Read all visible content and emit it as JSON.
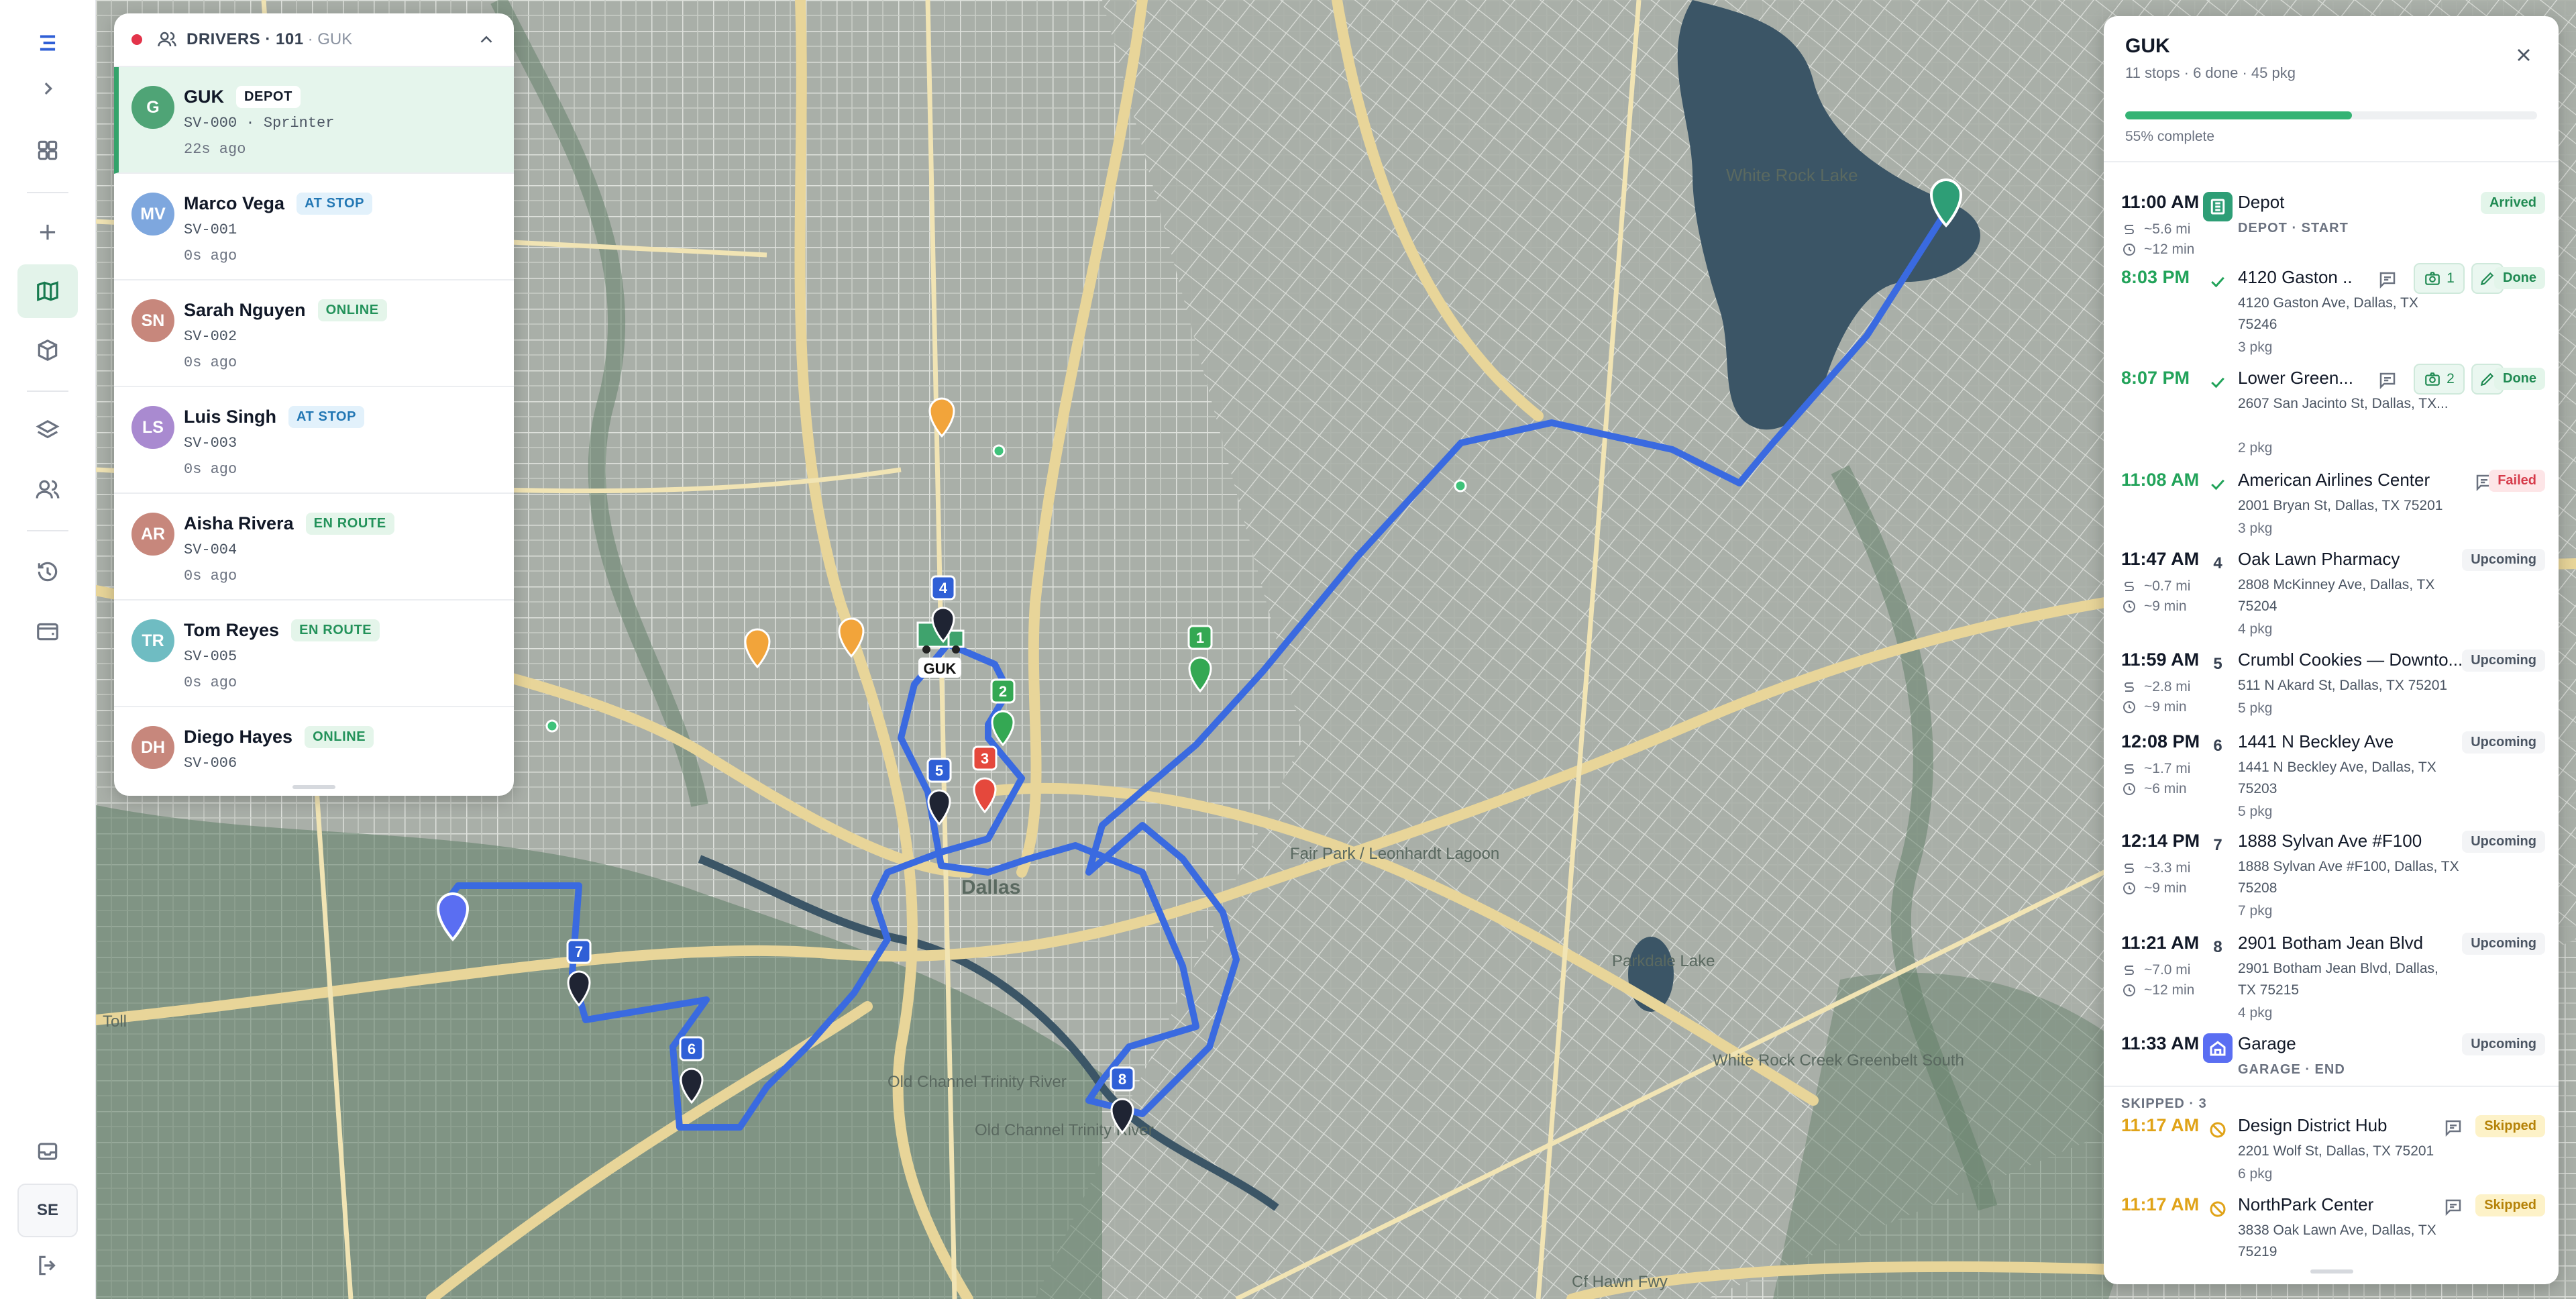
{
  "rail": {
    "items": [
      "logo",
      "expand",
      "dashboard",
      "add",
      "map",
      "packages",
      "layers",
      "users",
      "history",
      "wallet"
    ],
    "bottom": [
      "inbox",
      "user-initials",
      "logout"
    ],
    "user_initials": "SE"
  },
  "map": {
    "labels": [
      "White Rock Lake",
      "Dallas",
      "Parkdale Lake",
      "White Rock Creek Greenbelt South",
      "Old Channel Trinity River",
      "Old Channel Trinity River",
      "Fair Park / Leonhardt Lagoon",
      "Toll",
      "Cf Hawn Fwy"
    ],
    "markers": [
      {
        "label": "1",
        "color": "#34a853"
      },
      {
        "label": "2",
        "color": "#34a853"
      },
      {
        "label": "3",
        "color": "#e5483c"
      },
      {
        "label": "4",
        "color": "#2f5fd6"
      },
      {
        "label": "5",
        "color": "#2f5fd6"
      },
      {
        "label": "6",
        "color": "#2f5fd6"
      },
      {
        "label": "7",
        "color": "#2f5fd6"
      },
      {
        "label": "8",
        "color": "#2f5fd6"
      }
    ],
    "truck_label": "GUK"
  },
  "drivers": {
    "title": "DRIVERS · 101",
    "subtitle": "· GUK",
    "list": [
      {
        "initials": "G",
        "name": "GUK",
        "status": "DEPOT",
        "sub": "SV-000 · Sprinter",
        "time": "22s ago",
        "color": "#4fa476",
        "badge_bg": "#ffffff",
        "badge_fg": "#111827"
      },
      {
        "initials": "MV",
        "name": "Marco Vega",
        "status": "AT STOP",
        "sub": "SV-001",
        "time": "0s ago",
        "color": "#7ea7de",
        "badge_bg": "#e2f1fb",
        "badge_fg": "#2277b4"
      },
      {
        "initials": "SN",
        "name": "Sarah Nguyen",
        "status": "ONLINE",
        "sub": "SV-002",
        "time": "0s ago",
        "color": "#c7877c",
        "badge_bg": "#e4f5ea",
        "badge_fg": "#23925a"
      },
      {
        "initials": "LS",
        "name": "Luis Singh",
        "status": "AT STOP",
        "sub": "SV-003",
        "time": "0s ago",
        "color": "#a98ad0",
        "badge_bg": "#e2f1fb",
        "badge_fg": "#2277b4"
      },
      {
        "initials": "AR",
        "name": "Aisha Rivera",
        "status": "EN ROUTE",
        "sub": "SV-004",
        "time": "0s ago",
        "color": "#c7877c",
        "badge_bg": "#e4f5ea",
        "badge_fg": "#23925a"
      },
      {
        "initials": "TR",
        "name": "Tom Reyes",
        "status": "EN ROUTE",
        "sub": "SV-005",
        "time": "0s ago",
        "color": "#6fbcc2",
        "badge_bg": "#e4f5ea",
        "badge_fg": "#23925a"
      },
      {
        "initials": "DH",
        "name": "Diego Hayes",
        "status": "ONLINE",
        "sub": "SV-006",
        "time": "",
        "color": "#c7877c",
        "badge_bg": "#e4f5ea",
        "badge_fg": "#23925a"
      }
    ]
  },
  "route": {
    "title": "GUK",
    "summary": "11 stops · 6 done · 45 pkg",
    "progress_pct": 55,
    "progress_label": "55% complete",
    "stops": [
      {
        "time": "11:00 AM",
        "time_color": "default",
        "dist": "~5.6 mi",
        "dur": "~12 min",
        "marker": "depot",
        "name": "Depot",
        "addr": "DEPOT · START",
        "pkg": "",
        "status": "Arrived"
      },
      {
        "time": "8:03 PM",
        "time_color": "green",
        "marker": "check",
        "name": "4120 Gaston ...",
        "addr": "4120 Gaston Ave, Dallas, TX 75246",
        "pkg": "3 pkg",
        "photos": "1",
        "status": "Done"
      },
      {
        "time": "8:07 PM",
        "time_color": "green",
        "marker": "check",
        "name": "Lower Green...",
        "addr": "2607 San Jacinto St, Dallas, TX...",
        "pkg": "2 pkg",
        "photos": "2",
        "status": "Done"
      },
      {
        "time": "11:08 AM",
        "time_color": "green",
        "marker": "check",
        "name": "American Airlines Center",
        "addr": "2001 Bryan St, Dallas, TX 75201",
        "pkg": "3 pkg",
        "status": "Failed"
      },
      {
        "time": "11:47 AM",
        "time_color": "default",
        "dist": "~0.7 mi",
        "dur": "~9 min",
        "marker": "4",
        "name": "Oak Lawn Pharmacy",
        "addr": "2808 McKinney Ave, Dallas, TX 75204",
        "pkg": "4 pkg",
        "status": "Upcoming"
      },
      {
        "time": "11:59 AM",
        "time_color": "default",
        "dist": "~2.8 mi",
        "dur": "~9 min",
        "marker": "5",
        "name": "Crumbl Cookies — Downto...",
        "addr": "511 N Akard St, Dallas, TX 75201",
        "pkg": "5 pkg",
        "status": "Upcoming"
      },
      {
        "time": "12:08 PM",
        "time_color": "default",
        "dist": "~1.7 mi",
        "dur": "~6 min",
        "marker": "6",
        "name": "1441 N Beckley Ave",
        "addr": "1441 N Beckley Ave, Dallas, TX 75203",
        "pkg": "5 pkg",
        "status": "Upcoming"
      },
      {
        "time": "12:14 PM",
        "time_color": "default",
        "dist": "~3.3 mi",
        "dur": "~9 min",
        "marker": "7",
        "name": "1888 Sylvan Ave #F100",
        "addr": "1888 Sylvan Ave #F100, Dallas, TX 75208",
        "pkg": "7 pkg",
        "status": "Upcoming"
      },
      {
        "time": "11:21 AM",
        "time_color": "default",
        "dist": "~7.0 mi",
        "dur": "~12 min",
        "marker": "8",
        "name": "2901 Botham Jean Blvd",
        "addr": "2901 Botham Jean Blvd, Dallas, TX 75215",
        "pkg": "4 pkg",
        "status": "Upcoming"
      },
      {
        "time": "11:33 AM",
        "time_color": "default",
        "marker": "garage",
        "name": "Garage",
        "addr": "GARAGE · END",
        "pkg": "",
        "status": "Upcoming"
      }
    ],
    "skipped_header": "SKIPPED · 3",
    "skipped": [
      {
        "time": "11:17 AM",
        "name": "Design District Hub",
        "addr": "2201 Wolf St, Dallas, TX 75201",
        "pkg": "6 pkg",
        "status": "Skipped"
      },
      {
        "time": "11:17 AM",
        "name": "NorthPark Center",
        "addr": "3838 Oak Lawn Ave, Dallas, TX 75219",
        "pkg": "",
        "status": "Skipped"
      }
    ]
  }
}
